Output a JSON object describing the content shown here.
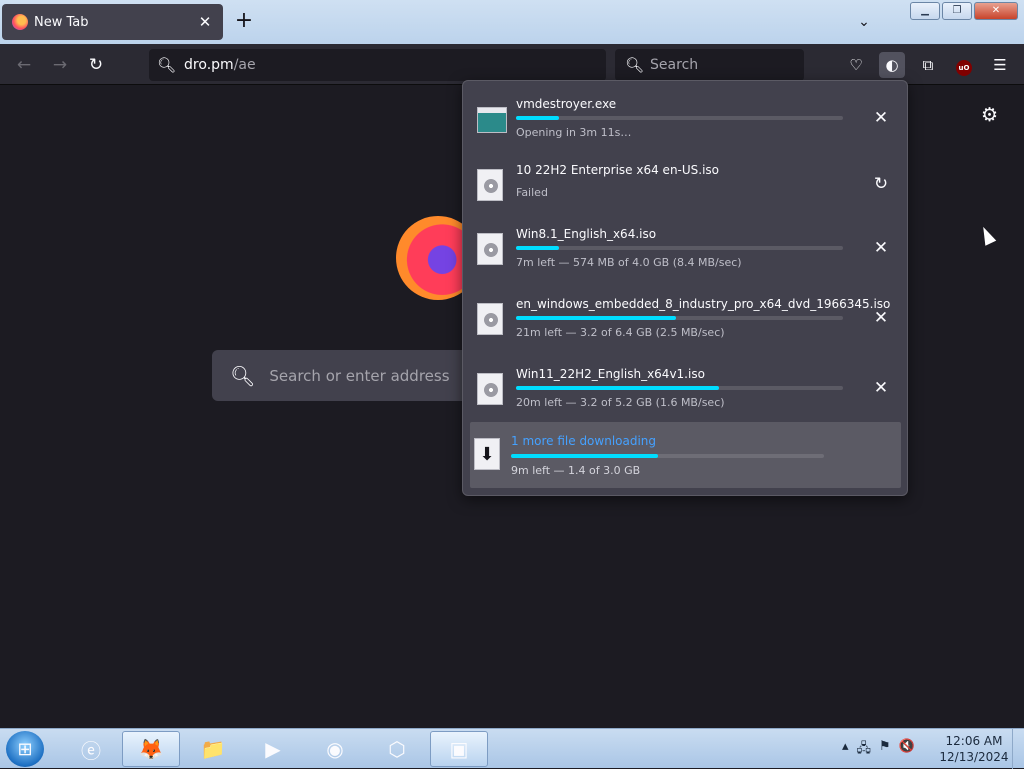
{
  "browser": {
    "tab_title": "New Tab",
    "url_host": "dro.pm",
    "url_path": "/ae",
    "search_placeholder": "Search",
    "newtab_search_placeholder": "Search or enter address"
  },
  "downloads": [
    {
      "name": "vmdestroyer.exe",
      "status": "Opening in 3m 11s…",
      "progress": 0.13,
      "icon": "exe-file-icon",
      "action": "cancel"
    },
    {
      "name": "10 22H2 Enterprise x64 en-US.iso",
      "status": "Failed",
      "progress": null,
      "icon": "disc-file-icon",
      "action": "retry"
    },
    {
      "name": "Win8.1_English_x64.iso",
      "status": "7m left — 574 MB of 4.0 GB (8.4 MB/sec)",
      "progress": 0.13,
      "icon": "disc-file-icon",
      "action": "cancel"
    },
    {
      "name": "en_windows_embedded_8_industry_pro_x64_dvd_1966345.iso",
      "status": "21m left — 3.2 of 6.4 GB (2.5 MB/sec)",
      "progress": 0.49,
      "icon": "disc-file-icon",
      "action": "cancel"
    },
    {
      "name": "Win11_22H2_English_x64v1.iso",
      "status": "20m left — 3.2 of 5.2 GB (1.6 MB/sec)",
      "progress": 0.62,
      "icon": "disc-file-icon",
      "action": "cancel"
    }
  ],
  "summary": {
    "label": "1 more file downloading",
    "status": "9m left — 1.4 of 3.0 GB",
    "progress": 0.47
  },
  "taskbar": {
    "time": "12:06 AM",
    "date": "12/13/2024"
  },
  "colors": {
    "accent": "#00ddff",
    "link": "#45a1ff",
    "panel": "#42414d"
  }
}
